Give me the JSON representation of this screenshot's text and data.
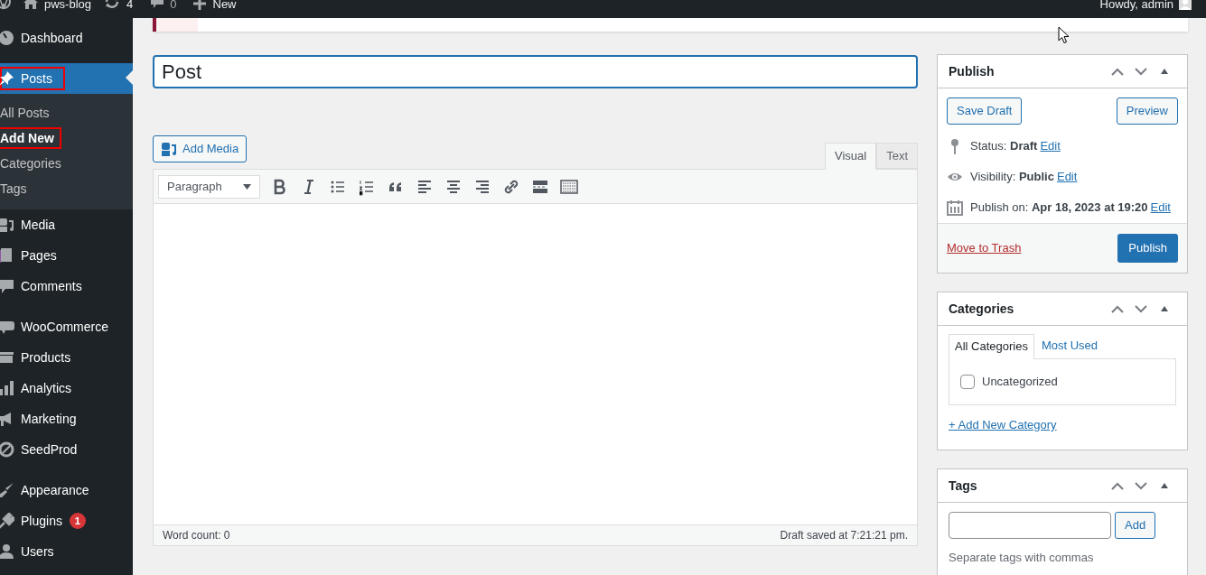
{
  "admin_bar": {
    "site": "pws-blog",
    "updates": "4",
    "comments": "0",
    "new": "New",
    "greeting": "Howdy, admin"
  },
  "sidebar": {
    "groups": [
      {
        "items": [
          {
            "label": "Dashboard",
            "current": false,
            "highlighted": false
          }
        ]
      },
      {
        "items": [
          {
            "label": "Posts",
            "current": true,
            "highlighted": true,
            "children": [
              {
                "label": "All Posts",
                "current": false,
                "highlighted": false
              },
              {
                "label": "Add New",
                "current": true,
                "highlighted": true
              },
              {
                "label": "Categories",
                "current": false,
                "highlighted": false
              },
              {
                "label": "Tags",
                "current": false,
                "highlighted": false
              }
            ]
          },
          {
            "label": "Media",
            "current": false,
            "highlighted": false
          },
          {
            "label": "Pages",
            "current": false,
            "highlighted": false
          },
          {
            "label": "Comments",
            "current": false,
            "highlighted": false
          }
        ]
      },
      {
        "items": [
          {
            "label": "WooCommerce",
            "current": false,
            "highlighted": false
          },
          {
            "label": "Products",
            "current": false,
            "highlighted": false
          },
          {
            "label": "Analytics",
            "current": false,
            "highlighted": false
          },
          {
            "label": "Marketing",
            "current": false,
            "highlighted": false
          },
          {
            "label": "SeedProd",
            "current": false,
            "highlighted": false
          }
        ]
      },
      {
        "items": [
          {
            "label": "Appearance",
            "current": false,
            "highlighted": false
          },
          {
            "label": "Plugins",
            "current": false,
            "highlighted": false,
            "badge": "1"
          },
          {
            "label": "Users",
            "current": false,
            "highlighted": false
          }
        ]
      }
    ]
  },
  "editor": {
    "title": "Post",
    "add_media": "Add Media",
    "tabs": [
      {
        "label": "Visual",
        "selected": true
      },
      {
        "label": "Text",
        "selected": false
      }
    ],
    "format": "Paragraph",
    "word_count": "Word count: 0",
    "draft_saved": "Draft saved at 7:21:21 pm."
  },
  "publish_box": {
    "title": "Publish",
    "save_draft": "Save Draft",
    "preview": "Preview",
    "rows": [
      {
        "label": "Status:",
        "value": "Draft",
        "action": "Edit"
      },
      {
        "label": "Visibility:",
        "value": "Public",
        "action": "Edit"
      },
      {
        "label": "Publish on:",
        "value": "Apr 18, 2023 at 19:20",
        "action": "Edit"
      }
    ],
    "trash": "Move to Trash",
    "publish": "Publish"
  },
  "categories_box": {
    "title": "Categories",
    "tabs": [
      {
        "label": "All Categories",
        "selected": true
      },
      {
        "label": "Most Used",
        "selected": false
      }
    ],
    "items": [
      {
        "label": "Uncategorized",
        "checked": false
      }
    ],
    "add_link": "+ Add New Category"
  },
  "tags_box": {
    "title": "Tags",
    "add": "Add",
    "hint": "Separate tags with commas"
  }
}
